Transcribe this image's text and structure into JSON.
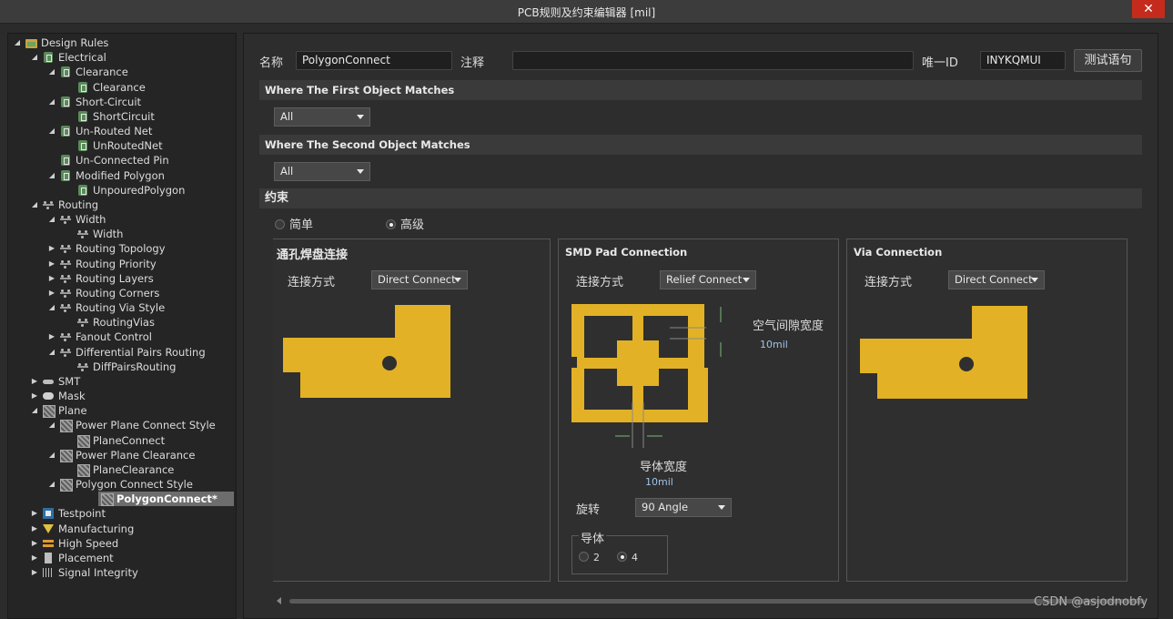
{
  "window": {
    "title": "PCB规则及约束编辑器 [mil]",
    "close_glyph": "✕"
  },
  "tree": [
    {
      "label": "Design Rules",
      "level": 0,
      "expander": "down",
      "icon": "folder-icon"
    },
    {
      "label": "Electrical",
      "level": 1,
      "expander": "down",
      "icon": "rule-icon"
    },
    {
      "label": "Clearance",
      "level": 2,
      "expander": "down",
      "icon": "rule-icon"
    },
    {
      "label": "Clearance",
      "level": 3,
      "expander": "",
      "icon": "rule-icon"
    },
    {
      "label": "Short-Circuit",
      "level": 2,
      "expander": "down",
      "icon": "rule-icon"
    },
    {
      "label": "ShortCircuit",
      "level": 3,
      "expander": "",
      "icon": "rule-icon"
    },
    {
      "label": "Un-Routed Net",
      "level": 2,
      "expander": "down",
      "icon": "rule-icon"
    },
    {
      "label": "UnRoutedNet",
      "level": 3,
      "expander": "",
      "icon": "rule-icon"
    },
    {
      "label": "Un-Connected Pin",
      "level": 2,
      "expander": "",
      "icon": "rule-icon"
    },
    {
      "label": "Modified Polygon",
      "level": 2,
      "expander": "down",
      "icon": "rule-icon"
    },
    {
      "label": "UnpouredPolygon",
      "level": 3,
      "expander": "",
      "icon": "rule-icon"
    },
    {
      "label": "Routing",
      "level": 1,
      "expander": "down",
      "icon": "route-icon"
    },
    {
      "label": "Width",
      "level": 2,
      "expander": "down",
      "icon": "route-icon"
    },
    {
      "label": "Width",
      "level": 3,
      "expander": "",
      "icon": "route-icon"
    },
    {
      "label": "Routing Topology",
      "level": 2,
      "expander": "right",
      "icon": "route-icon"
    },
    {
      "label": "Routing Priority",
      "level": 2,
      "expander": "right",
      "icon": "route-icon"
    },
    {
      "label": "Routing Layers",
      "level": 2,
      "expander": "right",
      "icon": "route-icon"
    },
    {
      "label": "Routing Corners",
      "level": 2,
      "expander": "right",
      "icon": "route-icon"
    },
    {
      "label": "Routing Via Style",
      "level": 2,
      "expander": "down",
      "icon": "route-icon"
    },
    {
      "label": "RoutingVias",
      "level": 3,
      "expander": "",
      "icon": "route-icon"
    },
    {
      "label": "Fanout Control",
      "level": 2,
      "expander": "right",
      "icon": "route-icon"
    },
    {
      "label": "Differential Pairs Routing",
      "level": 2,
      "expander": "down",
      "icon": "route-icon"
    },
    {
      "label": "DiffPairsRouting",
      "level": 3,
      "expander": "",
      "icon": "route-icon"
    },
    {
      "label": "SMT",
      "level": 1,
      "expander": "right",
      "icon": "smt-icon"
    },
    {
      "label": "Mask",
      "level": 1,
      "expander": "right",
      "icon": "mask-icon"
    },
    {
      "label": "Plane",
      "level": 1,
      "expander": "down",
      "icon": "plane-icon"
    },
    {
      "label": "Power Plane Connect Style",
      "level": 2,
      "expander": "down",
      "icon": "plane-icon"
    },
    {
      "label": "PlaneConnect",
      "level": 3,
      "expander": "",
      "icon": "plane-icon"
    },
    {
      "label": "Power Plane Clearance",
      "level": 2,
      "expander": "down",
      "icon": "plane-icon"
    },
    {
      "label": "PlaneClearance",
      "level": 3,
      "expander": "",
      "icon": "plane-icon"
    },
    {
      "label": "Polygon Connect Style",
      "level": 2,
      "expander": "down",
      "icon": "plane-icon"
    },
    {
      "label": "PolygonConnect*",
      "level": 3,
      "expander": "",
      "icon": "plane-icon",
      "selected": true
    },
    {
      "label": "Testpoint",
      "level": 1,
      "expander": "right",
      "icon": "testpoint-icon"
    },
    {
      "label": "Manufacturing",
      "level": 1,
      "expander": "right",
      "icon": "manufacturing-icon"
    },
    {
      "label": "High Speed",
      "level": 1,
      "expander": "right",
      "icon": "high-speed-icon"
    },
    {
      "label": "Placement",
      "level": 1,
      "expander": "right",
      "icon": "placement-icon"
    },
    {
      "label": "Signal Integrity",
      "level": 1,
      "expander": "right",
      "icon": "signal-integrity-icon"
    }
  ],
  "header": {
    "name_label": "名称",
    "name_value": "PolygonConnect",
    "comment_label": "注释",
    "comment_value": "",
    "uid_label": "唯一ID",
    "uid_value": "INYKQMUI",
    "test_button": "测试语句"
  },
  "first_match": {
    "title": "Where The First Object Matches",
    "value": "All"
  },
  "second_match": {
    "title": "Where The Second Object Matches",
    "value": "All"
  },
  "constraints": {
    "title": "约束",
    "mode_simple": "简单",
    "mode_advanced": "高级",
    "selected_mode": "advanced"
  },
  "through_hole": {
    "title": "通孔焊盘连接",
    "connect_label": "连接方式",
    "connect_value": "Direct Connect"
  },
  "smd": {
    "title": "SMD Pad Connection",
    "connect_label": "连接方式",
    "connect_value": "Relief Connect",
    "air_gap_label": "空气间隙宽度",
    "air_gap_value": "10mil",
    "conductor_width_label": "导体宽度",
    "conductor_width_value": "10mil",
    "rotation_label": "旋转",
    "rotation_value": "90 Angle",
    "conductors_label": "导体",
    "conductors_option_2": "2",
    "conductors_option_4": "4",
    "conductors_selected": "4"
  },
  "via": {
    "title": "Via Connection",
    "connect_label": "连接方式",
    "connect_value": "Direct Connect"
  },
  "watermark": "CSDN @asjodnobfy",
  "colors": {
    "copper": "#e2b125",
    "accent_blue": "#9ec3e8",
    "close_red": "#c42b1c",
    "selected_row": "#6d6d6d"
  }
}
